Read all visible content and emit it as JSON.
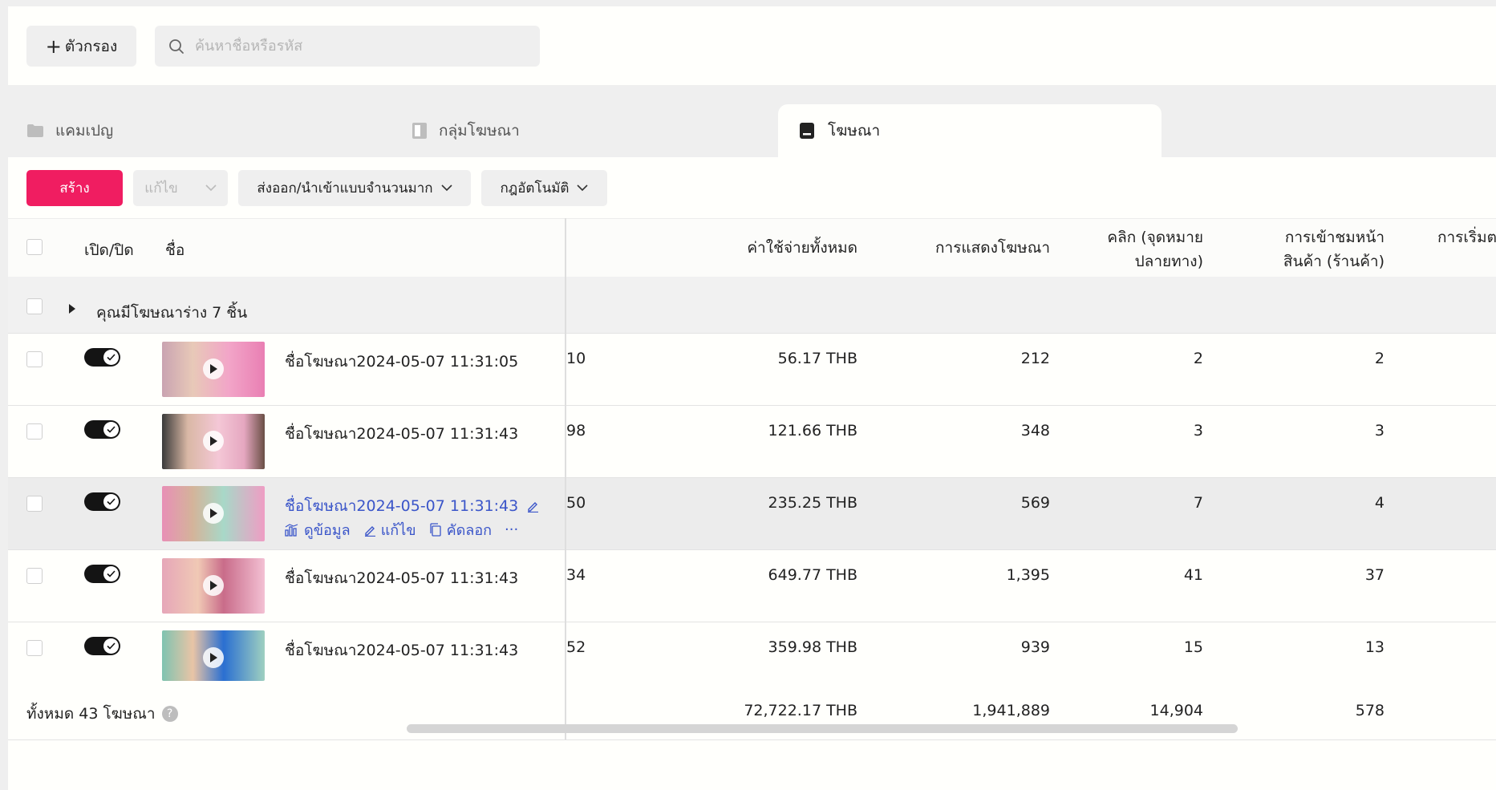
{
  "toolbar": {
    "filter_label": "ตัวกรอง",
    "search_placeholder": "ค้นหาชื่อหรือรหัส"
  },
  "tabs": [
    {
      "label": "แคมเปญ",
      "icon": "folder-icon"
    },
    {
      "label": "กลุ่มโฆษณา",
      "icon": "document-icon"
    },
    {
      "label": "โฆษณา",
      "icon": "ad-icon",
      "active": true
    }
  ],
  "actions": {
    "create": "สร้าง",
    "edit": "แก้ไข",
    "bulk": "ส่งออก/นำเข้าแบบจำนวนมาก",
    "rules": "กฎอัตโนมัติ"
  },
  "columns": {
    "toggle": "เปิด/ปิด",
    "name": "ชื่อ",
    "spend": "ค่าใช้จ่ายทั้งหมด",
    "impressions": "การแสดงโฆษณา",
    "clicks_1": "คลิก (จุดหมาย",
    "clicks_2": "ปลายทาง)",
    "pageviews_1": "การเข้าชมหน้า",
    "pageviews_2": "สินค้า (ร้านค้า)",
    "cutoff": "การเริ่มต"
  },
  "drafts": "คุณมีโฆษณาร่าง 7 ชิ้น",
  "rows": [
    {
      "name": "ชื่อโฆษณา2024-05-07 11:31:05",
      "prev": "10",
      "spend": "56.17 THB",
      "impressions": "212",
      "clicks": "2",
      "pageviews": "2"
    },
    {
      "name": "ชื่อโฆษณา2024-05-07 11:31:43",
      "prev": "98",
      "spend": "121.66 THB",
      "impressions": "348",
      "clicks": "3",
      "pageviews": "3"
    },
    {
      "name": "ชื่อโฆษณา2024-05-07 11:31:43",
      "prev": "50",
      "spend": "235.25 THB",
      "impressions": "569",
      "clicks": "7",
      "pageviews": "4"
    },
    {
      "name": "ชื่อโฆษณา2024-05-07 11:31:43",
      "prev": "34",
      "spend": "649.77 THB",
      "impressions": "1,395",
      "clicks": "41",
      "pageviews": "37"
    },
    {
      "name": "ชื่อโฆษณา2024-05-07 11:31:43",
      "prev": "52",
      "spend": "359.98 THB",
      "impressions": "939",
      "clicks": "15",
      "pageviews": "13"
    }
  ],
  "row_actions": {
    "view": "ดูข้อมูล",
    "edit": "แก้ไข",
    "copy": "คัดลอก",
    "more": "···"
  },
  "totals": {
    "label": "ทั้งหมด 43 โฆษณา",
    "help": "?",
    "spend": "72,722.17 THB",
    "impressions": "1,941,889",
    "clicks": "14,904",
    "pageviews": "578"
  },
  "colors": {
    "accent": "#f01d61",
    "link": "#3a55c9"
  }
}
